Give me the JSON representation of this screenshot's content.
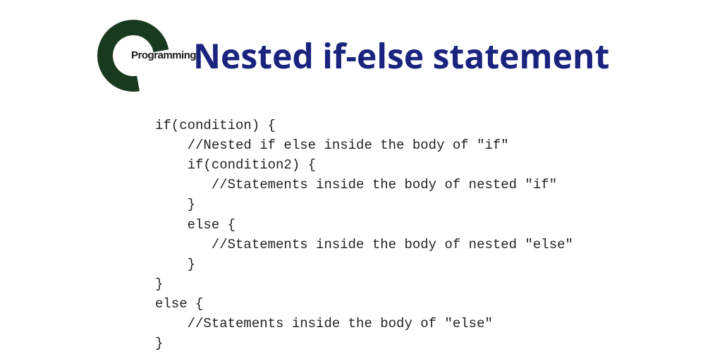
{
  "logo": {
    "inner_text": "Programming"
  },
  "title": "Nested if-else statement",
  "code": {
    "l0": "if(condition) {",
    "l1": "    //Nested if else inside the body of \"if\"",
    "l2": "    if(condition2) {",
    "l3": "       //Statements inside the body of nested \"if\"",
    "l4": "    }",
    "l5": "    else {",
    "l6": "       //Statements inside the body of nested \"else\"",
    "l7": "    }",
    "l8": "}",
    "l9": "else {",
    "l10": "    //Statements inside the body of \"else\"",
    "l11": "}"
  }
}
